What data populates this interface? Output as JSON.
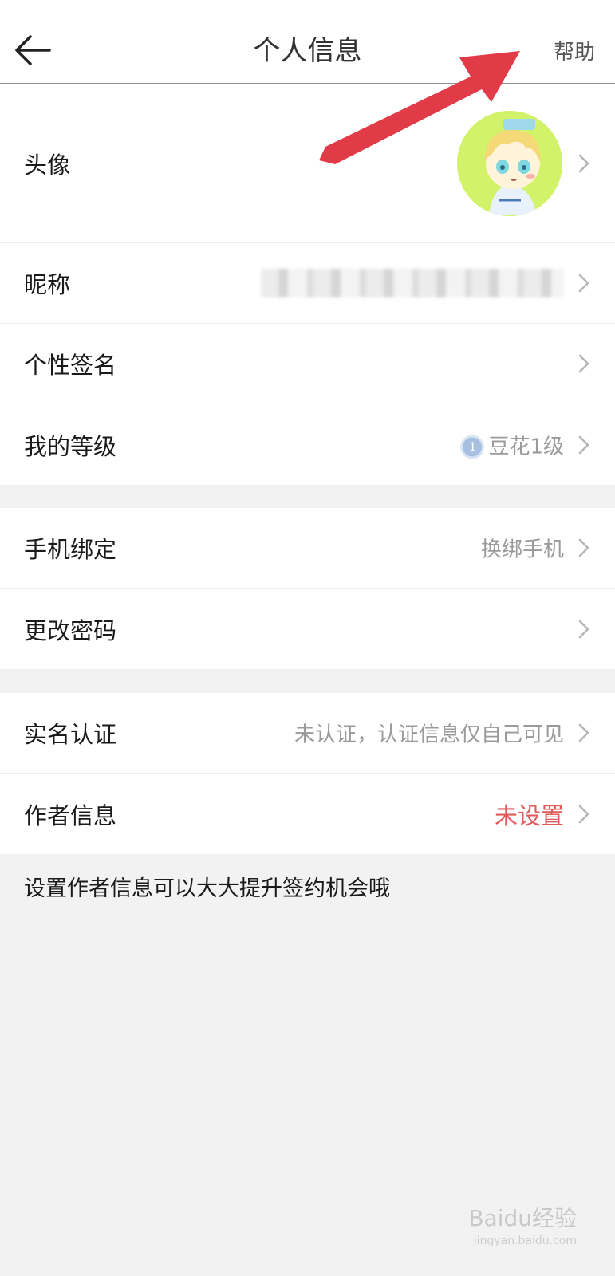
{
  "header": {
    "back_icon": "arrow-left-icon",
    "title": "个人信息",
    "help_label": "帮助"
  },
  "profile_group": [
    {
      "label": "头像",
      "type": "avatar"
    },
    {
      "label": "昵称",
      "type": "blurred"
    },
    {
      "label": "个性签名",
      "value": ""
    },
    {
      "label": "我的等级",
      "badge": "1",
      "value": "豆花1级"
    }
  ],
  "security_group": [
    {
      "label": "手机绑定",
      "value": "换绑手机"
    },
    {
      "label": "更改密码",
      "value": ""
    }
  ],
  "author_group": [
    {
      "label": "实名认证",
      "value": "未认证，认证信息仅自己可见"
    },
    {
      "label": "作者信息",
      "value": "未设置"
    }
  ],
  "footnote": "设置作者信息可以大大提升签约机会哦",
  "colors": {
    "alert": "#e05a5a",
    "annotation_arrow": "#e23b48",
    "secondary_text": "#9a9a9a",
    "page_background": "#f2f2f2"
  },
  "watermark": {
    "brand": "Baidu经验",
    "url": "jingyan.baidu.com"
  }
}
